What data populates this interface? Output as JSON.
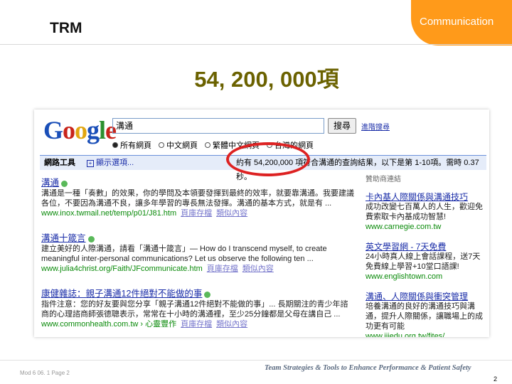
{
  "slide": {
    "section": "TRM",
    "tab_label": "Communication",
    "headline": "54, 200, 000項",
    "footer_left": "Mod 6 06. 1 Page 2",
    "footer_tagline": "Team Strategies & Tools to Enhance Performance & Patient Safety",
    "page_number": "2"
  },
  "google": {
    "logo": "Google",
    "query": "溝通",
    "search_button": "搜尋",
    "advanced_link": "進階搜尋",
    "radios": [
      {
        "label": "所有網頁",
        "selected": true
      },
      {
        "label": "中文網頁",
        "selected": false
      },
      {
        "label": "繁體中文網頁",
        "selected": false
      },
      {
        "label": "台灣的網頁",
        "selected": false
      }
    ],
    "toolbar": {
      "tools_label": "網路工具",
      "show_options": "顯示選項...",
      "stats": "約有 54,200,000 項符合溝通的查詢結果，以下是第 1-10項。需時 0.37 秒。"
    },
    "results": [
      {
        "title": "溝通",
        "snippet": "溝通是一種「奏數」的效果，你的學問及本領要發揮到最終的效率，就要靠溝通。我要建議各位，不要因為溝通不良，讓多年學習的專長無法發揮。溝通的基本方式，就是有 ...",
        "url": "www.inox.twmail.net/temp/p01/J81.htm",
        "cache": "頁庫存檔",
        "similar": "類似內容"
      },
      {
        "title": "溝通十箴言",
        "snippet": "建立美好的人際溝通，請看「溝通十箴言」— How do I transcend myself, to create meaningful inter-personal communications? Let us observe the following ten ...",
        "url": "www.julia4christ.org/Faith/JFcommunicate.htm",
        "cache": "頁庫存檔",
        "similar": "類似內容"
      },
      {
        "title": "康健雜誌：親子溝通12件絕對不能做的事",
        "snippet": "指件注意：您的好友要與您分享「親子溝通12件絕對不能做的事」... 長期關注的青少年諮商的心理諮商師張德聰表示，常常在十小時的溝通裡，至少25分鐘都是父母在講自己 ...",
        "url": "www.commonhealth.com.tw › 心靈豐作",
        "cache": "頁庫存檔",
        "similar": "類似內容"
      }
    ],
    "sponsored": {
      "header": "贊助商連結",
      "ads": [
        {
          "title": "卡內基人際關係與溝通技巧",
          "desc": "成功改變七百萬人的人生，歡迎免費索取卡內基成功智慧!",
          "url": "www.carnegie.com.tw"
        },
        {
          "title": "英文學習網 - 7天免費",
          "desc": "24小時真人線上會話課程，送7天免費線上學習+10堂口語課!",
          "url": "www.englishtown.com"
        },
        {
          "title": "溝通、人際關係與衝突管理",
          "desc": "培養溝通的良好的溝通技巧與溝通，提升人際關係，讓職場上的成功更有可能",
          "url": "www.iiiedu.org.tw/fites/"
        }
      ]
    }
  }
}
